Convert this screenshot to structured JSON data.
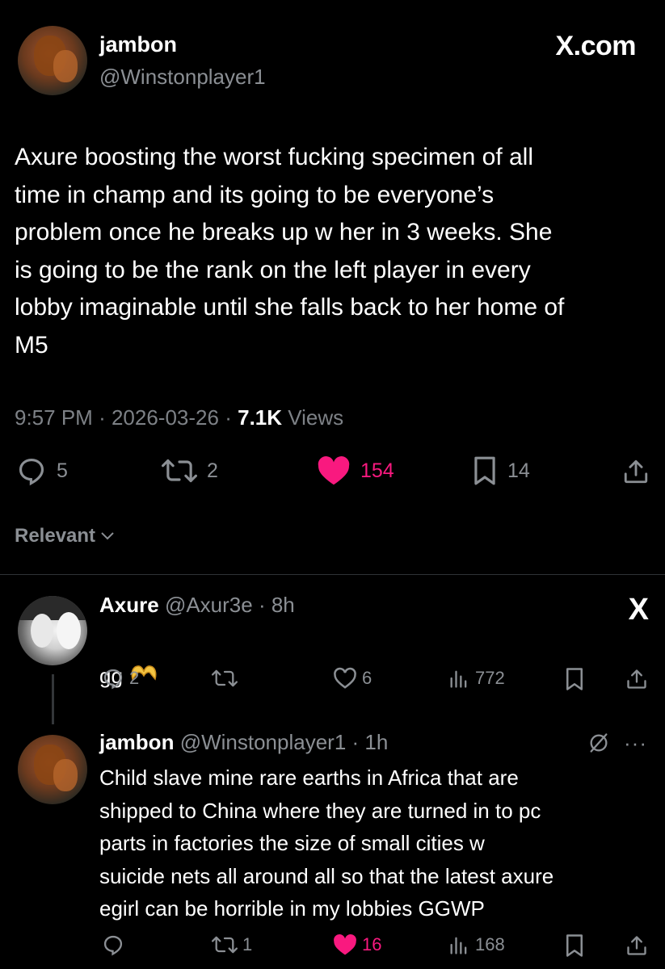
{
  "main": {
    "author_name": "jambon",
    "author_handle": "@Winstonplayer1",
    "brand": "X.com",
    "text": "Axure boosting the worst fucking specimen of all\ntime in champ and its going to be everyone’s\nproblem once he breaks up w her in 3 weeks. She\nis going to be the rank on the left player in every\nlobby imaginable until she falls back to her home of\nM5",
    "time": "9:57 PM",
    "sep": "·",
    "date": "2026-03-26",
    "views_count": "7.1K",
    "views_label": "Views",
    "replies": "5",
    "reposts": "2",
    "likes": "154",
    "bookmarks": "14",
    "like_color": "#f9197f"
  },
  "sort": {
    "label": "Relevant"
  },
  "replies": [
    {
      "name": "Axure",
      "handle": "@Axur3e",
      "age": "· 8h",
      "text": "gg",
      "replies": "2",
      "reposts": "",
      "likes": "6",
      "views": "772",
      "badge": "X"
    },
    {
      "name": "jambon",
      "handle": "@Winstonplayer1",
      "age": "· 1h",
      "text": "Child slave mine rare earths in Africa that are\nshipped to China where they are turned in to pc\nparts in factories the size of small cities w\nsuicide nets all around all so that the latest axure\negirl can be horrible in my lobbies GGWP",
      "replies": "",
      "reposts": "1",
      "likes": "16",
      "views": "168",
      "more": "···"
    }
  ]
}
